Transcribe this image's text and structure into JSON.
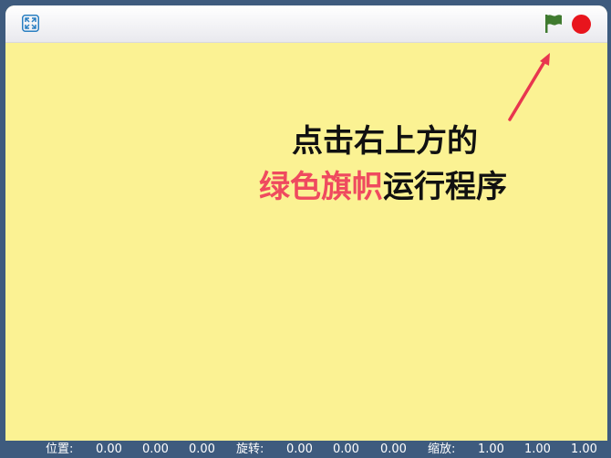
{
  "toolbar": {
    "fullscreen_icon": "fullscreen-icon",
    "green_flag_icon": "green-flag-icon",
    "stop_icon": "stop-icon",
    "flag_color": "#3f7a2f",
    "stop_color": "#e8151d"
  },
  "stage": {
    "background_color": "#fbf293",
    "hint_line1": "点击右上方的",
    "hint_highlight": "绿色旗帜",
    "hint_line2_rest": "运行程序",
    "highlight_color": "#ef4a5f",
    "arrow_color": "#e8364f"
  },
  "statusbar": {
    "position_label": "位置:",
    "position_values": [
      "0.00",
      "0.00",
      "0.00"
    ],
    "rotation_label": "旋转:",
    "rotation_values": [
      "0.00",
      "0.00",
      "0.00"
    ],
    "scale_label": "缩放:",
    "scale_values": [
      "1.00",
      "1.00",
      "1.00"
    ]
  }
}
